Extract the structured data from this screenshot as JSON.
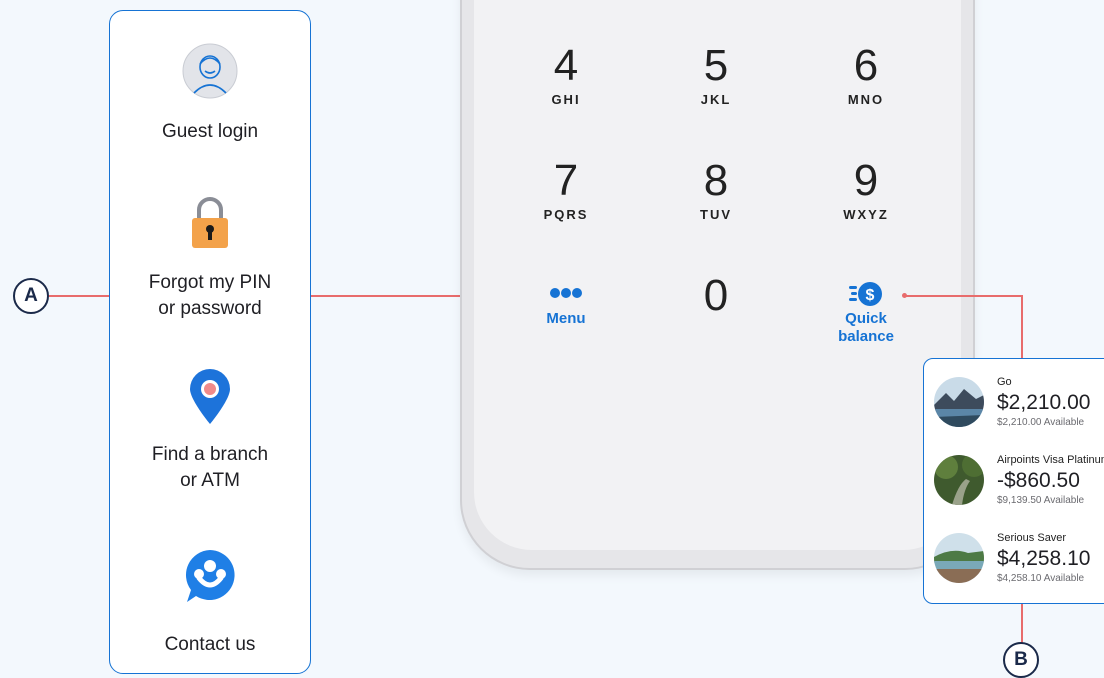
{
  "menu": {
    "items": [
      {
        "label": "Guest login",
        "icon": "guest-avatar-icon"
      },
      {
        "label": "Forgot my PIN\nor password",
        "icon": "padlock-icon"
      },
      {
        "label": "Find a branch\nor ATM",
        "icon": "map-pin-icon"
      },
      {
        "label": "Contact us",
        "icon": "contact-chat-icon"
      }
    ]
  },
  "keypad": {
    "keys": [
      {
        "digit": "4",
        "letters": "GHI"
      },
      {
        "digit": "5",
        "letters": "JKL"
      },
      {
        "digit": "6",
        "letters": "MNO"
      },
      {
        "digit": "7",
        "letters": "PQRS"
      },
      {
        "digit": "8",
        "letters": "TUV"
      },
      {
        "digit": "9",
        "letters": "WXYZ"
      },
      {
        "digit": "0",
        "letters": ""
      }
    ],
    "menu_label": "Menu",
    "quick_balance_label": "Quick\nbalance"
  },
  "callouts": {
    "a": "A",
    "b": "B"
  },
  "accounts": [
    {
      "name": "Go",
      "balance": "$2,210.00",
      "available": "$2,210.00 Available"
    },
    {
      "name": "Airpoints Visa Platinum",
      "balance": "-$860.50",
      "available": "$9,139.50 Available"
    },
    {
      "name": "Serious Saver",
      "balance": "$4,258.10",
      "available": "$4,258.10 Available"
    }
  ],
  "colors": {
    "accent": "#1673d4",
    "connector": "#e86c6c",
    "background": "#f3f8fd"
  }
}
